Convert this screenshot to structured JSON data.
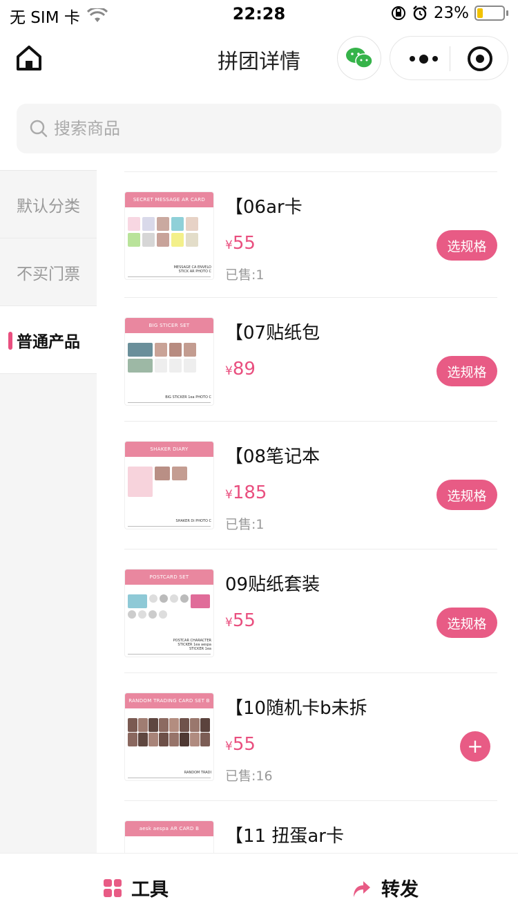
{
  "status_bar": {
    "carrier": "无 SIM 卡",
    "time": "22:28",
    "battery": "23%",
    "battery_level": 0.23
  },
  "nav": {
    "title": "拼团详情"
  },
  "search": {
    "placeholder": "搜索商品"
  },
  "sidebar": {
    "items": [
      {
        "label": "默认分类"
      },
      {
        "label": "不买门票"
      },
      {
        "label": "普通产品"
      }
    ]
  },
  "products": [
    {
      "name": "【06ar卡",
      "currency": "¥",
      "price": "55",
      "sold": "已售:1",
      "action": "选规格",
      "thumb_title": "SECRET MESSAGE AR CARD",
      "thumb_caption": "MESSAGE CA ENVELO STICK AR PHOTO C"
    },
    {
      "name": "【07贴纸包",
      "currency": "¥",
      "price": "89",
      "sold": "",
      "action": "选规格",
      "thumb_title": "BIG STICER SET",
      "thumb_caption": "BIG STICKER 1ea PHOTO C"
    },
    {
      "name": "【08笔记本",
      "currency": "¥",
      "price": "185",
      "sold": "已售:1",
      "action": "选规格",
      "thumb_title": "SHAKER DIARY",
      "thumb_caption": "SHAKER Di PHOTO C"
    },
    {
      "name": "09贴纸套装",
      "currency": "¥",
      "price": "55",
      "sold": "",
      "action": "选规格",
      "thumb_title": "POSTCARD SET",
      "thumb_caption": "POSTCAR CHARACTER STICKER 1ea aespa STICKER 1ea"
    },
    {
      "name": "【10随机卡b未拆",
      "currency": "¥",
      "price": "55",
      "sold": "已售:16",
      "action": "+",
      "thumb_title": "RANDOM TRADING CARD SET B",
      "thumb_caption": "RANDOM TRADI"
    },
    {
      "name": "【11 扭蛋ar卡",
      "currency": "",
      "price": "",
      "sold": "",
      "action": "",
      "thumb_title": "aesk aespa AR CARD B",
      "thumb_caption": ""
    }
  ],
  "bottom": {
    "tools": "工具",
    "share": "转发"
  },
  "colors": {
    "accent": "#e85b85",
    "sidebar_bg": "#f5f5f5"
  }
}
